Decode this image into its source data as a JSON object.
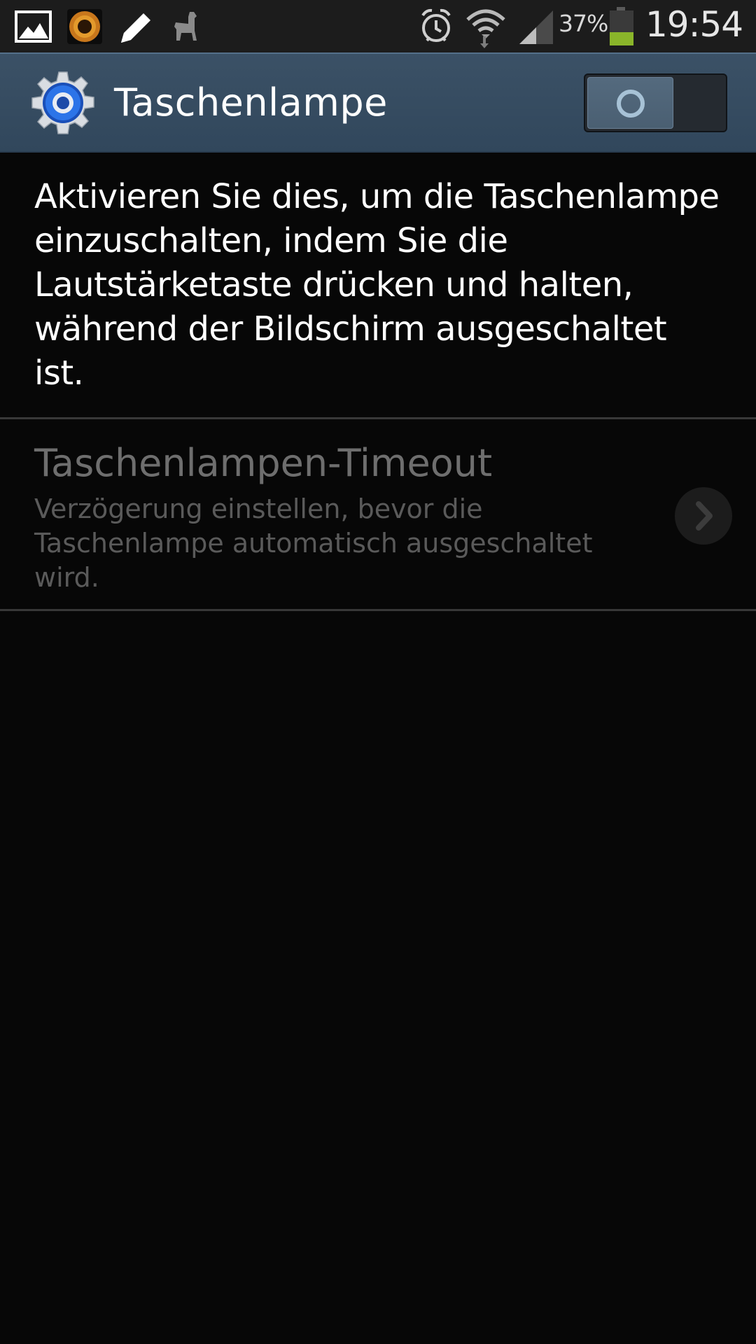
{
  "status_bar": {
    "left_icons": [
      "gallery-icon",
      "sunflower-app-icon",
      "pencil-icon",
      "llama-icon"
    ],
    "right_icons": [
      "alarm-clock-icon",
      "wifi-icon",
      "signal-icon",
      "battery-icon"
    ],
    "battery_percent": "37%",
    "battery_level": 0.37,
    "time": "19:54",
    "battery_color": "#8ab52a"
  },
  "action_bar": {
    "icon": "settings-gear-icon",
    "title": "Taschenlampe",
    "switch_state": "off",
    "background": "#34495e"
  },
  "description": {
    "text": "Aktivieren Sie dies, um die Taschenlampe\neinzuschalten, indem Sie die\nLautstärketaste drücken und halten,\nwährend der Bildschirm ausgeschaltet\nist."
  },
  "settings": {
    "timeout": {
      "title": "Taschenlampen-Timeout",
      "summary": "Verzögerung einstellen, bevor die\nTaschenlampe automatisch ausgeschaltet\nwird.",
      "enabled": false,
      "icon": "chevron-right-icon"
    }
  }
}
